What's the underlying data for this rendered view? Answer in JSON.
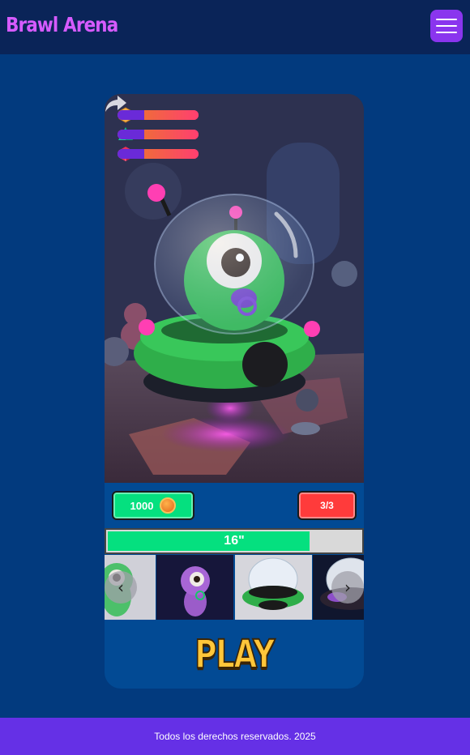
{
  "header": {
    "brand": "Brawl Arena",
    "menu_icon": "hamburger-menu-icon"
  },
  "character": {
    "name": "",
    "image": "alien-ufo-character",
    "stats": [
      {
        "icon": "hexagon-gem-icon",
        "color": "#f5b14c",
        "value": 0.33
      },
      {
        "icon": "pyramid-gem-icon",
        "color": "#16c79a",
        "value": 0.33
      },
      {
        "icon": "cube-gem-icon",
        "color": "#e8315b",
        "value": 0.33
      }
    ],
    "share_icon": "share-arrow-icon"
  },
  "wallet": {
    "coins": "1000",
    "coin_icon": "coin-icon",
    "lives": "3/3"
  },
  "timer": {
    "label": "16\"",
    "progress": 0.8
  },
  "carousel": {
    "prev_icon": "chevron-left-icon",
    "next_icon": "chevron-right-icon",
    "items": [
      {
        "name": "green-alien-thumbnail"
      },
      {
        "name": "purple-alien-thumbnail"
      },
      {
        "name": "green-ufo-thumbnail"
      },
      {
        "name": "purple-ufo-thumbnail"
      }
    ]
  },
  "play_button": {
    "label": "PLAY"
  },
  "footer": {
    "text": "Todos los derechos reservados. 2025"
  },
  "colors": {
    "background": "#023a7e",
    "header": "#0a2458",
    "accent": "#8a35ee",
    "brand": "#d65bff",
    "footer": "#6530e6",
    "green": "#05e07f",
    "red": "#ff3b3b"
  }
}
